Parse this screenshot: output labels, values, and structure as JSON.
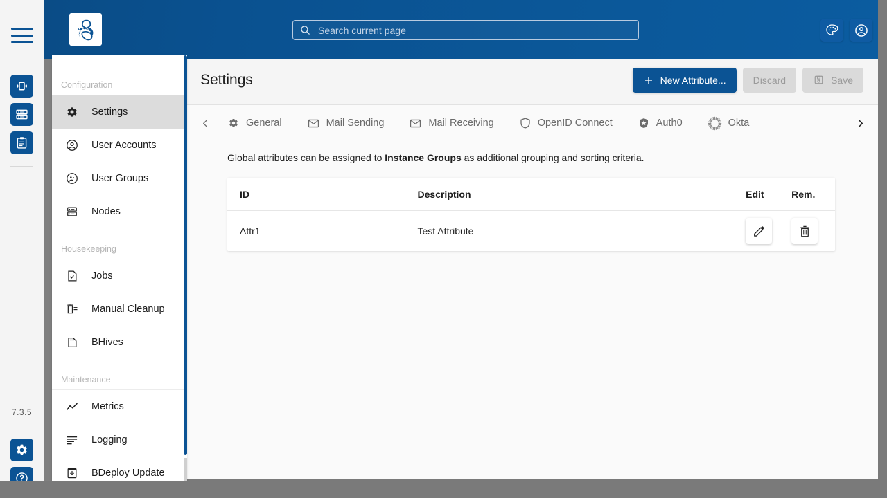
{
  "app": {
    "logo_icon": "bee-logo-icon",
    "version": "7.3.5"
  },
  "rail": {
    "menu_icon": "hamburger-menu-icon",
    "buttons": [
      {
        "icon": "instance-groups-icon",
        "name": "instance-groups"
      },
      {
        "icon": "software-repositories-icon",
        "name": "software-repositories"
      },
      {
        "icon": "reports-icon",
        "name": "reports"
      }
    ],
    "bottom_buttons": [
      {
        "icon": "gear-icon",
        "name": "administration"
      },
      {
        "icon": "help-icon",
        "name": "help"
      }
    ]
  },
  "header": {
    "search": {
      "placeholder": "Search current page",
      "value": "",
      "icon": "search-icon"
    },
    "actions": [
      {
        "icon": "palette-icon",
        "name": "theme-toggle"
      },
      {
        "icon": "user-circle-icon",
        "name": "user-account"
      }
    ]
  },
  "sidebar": {
    "sections": [
      {
        "label": "Configuration",
        "items": [
          {
            "label": "Settings",
            "icon": "gear-icon",
            "active": true
          },
          {
            "label": "User Accounts",
            "icon": "user-circle-icon",
            "active": false
          },
          {
            "label": "User Groups",
            "icon": "user-group-icon",
            "active": false
          },
          {
            "label": "Nodes",
            "icon": "server-icon",
            "active": false
          }
        ]
      },
      {
        "label": "Housekeeping",
        "items": [
          {
            "label": "Jobs",
            "icon": "document-check-icon",
            "active": false
          },
          {
            "label": "Manual Cleanup",
            "icon": "trash-list-icon",
            "active": false
          },
          {
            "label": "BHives",
            "icon": "hive-icon",
            "active": false
          }
        ]
      },
      {
        "label": "Maintenance",
        "items": [
          {
            "label": "Metrics",
            "icon": "line-chart-icon",
            "active": false
          },
          {
            "label": "Logging",
            "icon": "lines-icon",
            "active": false
          },
          {
            "label": "BDeploy Update",
            "icon": "download-box-icon",
            "active": false
          }
        ]
      }
    ]
  },
  "main": {
    "title": "Settings",
    "toolbar": {
      "new_attribute_label": "New Attribute...",
      "new_attribute_icon": "plus-icon",
      "discard_label": "Discard",
      "save_label": "Save",
      "save_icon": "save-disk-icon"
    },
    "tabs": {
      "prev_icon": "chevron-left-icon",
      "next_icon": "chevron-right-icon",
      "items": [
        {
          "label": "General",
          "icon": "gear-icon"
        },
        {
          "label": "Mail Sending",
          "icon": "envelope-icon"
        },
        {
          "label": "Mail Receiving",
          "icon": "envelope-icon"
        },
        {
          "label": "OpenID Connect",
          "icon": "shield-icon"
        },
        {
          "label": "Auth0",
          "icon": "auth0-icon"
        },
        {
          "label": "Okta",
          "icon": "okta-sunburst-icon"
        }
      ]
    },
    "description": {
      "prefix": "Global attributes can be assigned to ",
      "bold": "Instance Groups",
      "suffix": " as additional grouping and sorting criteria."
    },
    "table": {
      "columns": [
        "ID",
        "Description",
        "Edit",
        "Rem."
      ],
      "rows": [
        {
          "id": "Attr1",
          "description": "Test Attribute",
          "edit_icon": "pencil-icon",
          "remove_icon": "trash-icon"
        }
      ]
    }
  },
  "colors": {
    "brand_blue": "#0b5394",
    "header_blue": "#0a5190",
    "chrome_gray": "#7a7a7a"
  }
}
